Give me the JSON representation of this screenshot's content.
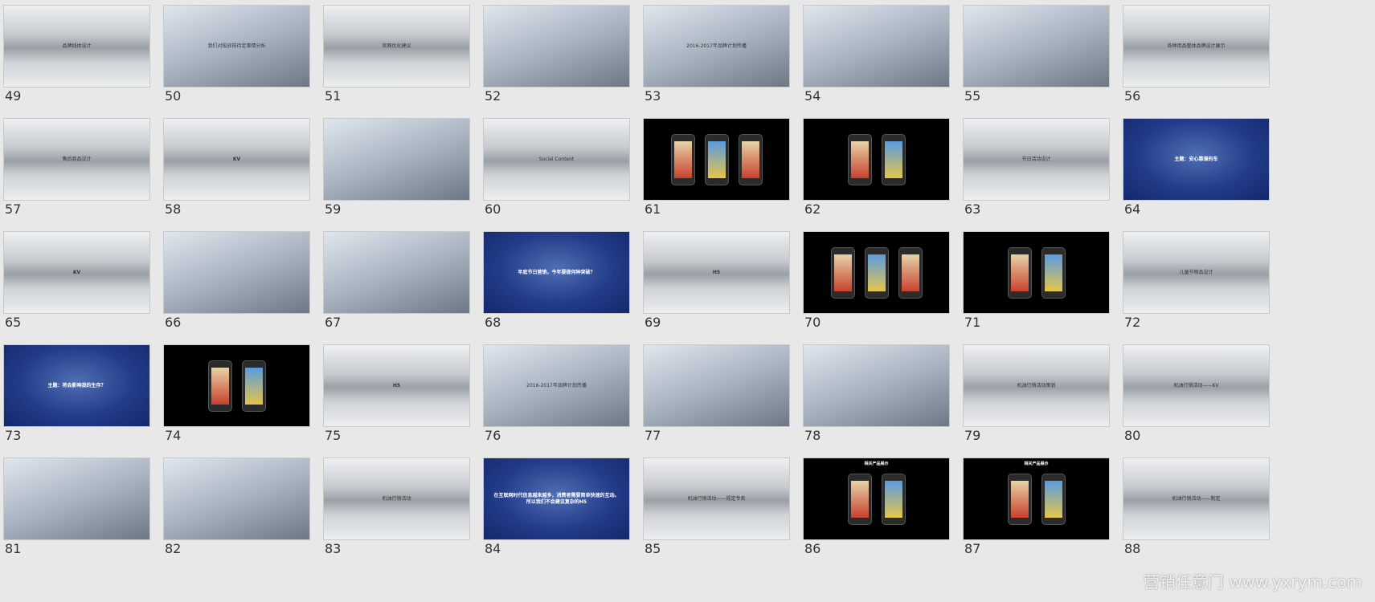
{
  "slides": [
    {
      "number": "49",
      "title": "品牌线体设计",
      "style": "silver"
    },
    {
      "number": "50",
      "title": "我们对投放前待定事情分析",
      "style": "photo"
    },
    {
      "number": "51",
      "title": "官网优化建议",
      "style": "silver"
    },
    {
      "number": "52",
      "title": "",
      "style": "photo"
    },
    {
      "number": "53",
      "title": "2016-2017年品牌计划传播",
      "style": "photo"
    },
    {
      "number": "54",
      "title": "",
      "style": "photo"
    },
    {
      "number": "55",
      "title": "",
      "style": "photo"
    },
    {
      "number": "56",
      "title": "各种用品整体品牌设计展示",
      "style": "silver"
    },
    {
      "number": "57",
      "title": "售后商品设计",
      "style": "silver"
    },
    {
      "number": "58",
      "title": "KV",
      "style": "silver"
    },
    {
      "number": "59",
      "title": "",
      "style": "photo"
    },
    {
      "number": "60",
      "title": "Social Content",
      "style": "silver"
    },
    {
      "number": "61",
      "title": "",
      "style": "phones"
    },
    {
      "number": "62",
      "title": "",
      "style": "phones"
    },
    {
      "number": "63",
      "title": "节日活动设计",
      "style": "silver"
    },
    {
      "number": "64",
      "title": "主题：安心靠谱的车",
      "style": "blue"
    },
    {
      "number": "65",
      "title": "KV",
      "style": "silver"
    },
    {
      "number": "66",
      "title": "",
      "style": "photo"
    },
    {
      "number": "67",
      "title": "",
      "style": "photo"
    },
    {
      "number": "68",
      "title": "年底节日营销，今年要做何种突破？",
      "style": "blue"
    },
    {
      "number": "69",
      "title": "H5",
      "style": "silver"
    },
    {
      "number": "70",
      "title": "",
      "style": "phones"
    },
    {
      "number": "71",
      "title": "",
      "style": "phones"
    },
    {
      "number": "72",
      "title": "儿童节物品设计",
      "style": "silver"
    },
    {
      "number": "73",
      "title": "主题：将会影响我的生存？",
      "style": "blue"
    },
    {
      "number": "74",
      "title": "",
      "style": "phones"
    },
    {
      "number": "75",
      "title": "H5",
      "style": "silver"
    },
    {
      "number": "76",
      "title": "2016-2017年品牌计划传播",
      "style": "photo"
    },
    {
      "number": "77",
      "title": "",
      "style": "photo"
    },
    {
      "number": "78",
      "title": "",
      "style": "photo"
    },
    {
      "number": "79",
      "title": "机油行销活动策划",
      "style": "silver"
    },
    {
      "number": "80",
      "title": "机油行销活动——KV",
      "style": "silver"
    },
    {
      "number": "81",
      "title": "",
      "style": "photo"
    },
    {
      "number": "82",
      "title": "",
      "style": "photo"
    },
    {
      "number": "83",
      "title": "机油行销活动",
      "style": "silver"
    },
    {
      "number": "84",
      "title": "在互联网时代信息越来越多，消费者需要简单快速的互动。所以我们不会建议复杂的H5",
      "style": "blue"
    },
    {
      "number": "85",
      "title": "机油行销活动——规定专卖",
      "style": "silver"
    },
    {
      "number": "86",
      "title": "相关产品展示",
      "style": "phones"
    },
    {
      "number": "87",
      "title": "相关产品展示",
      "style": "phones"
    },
    {
      "number": "88",
      "title": "机油行销活动——制定",
      "style": "silver"
    }
  ],
  "watermark": "营销任意门 www.yxrym.com"
}
